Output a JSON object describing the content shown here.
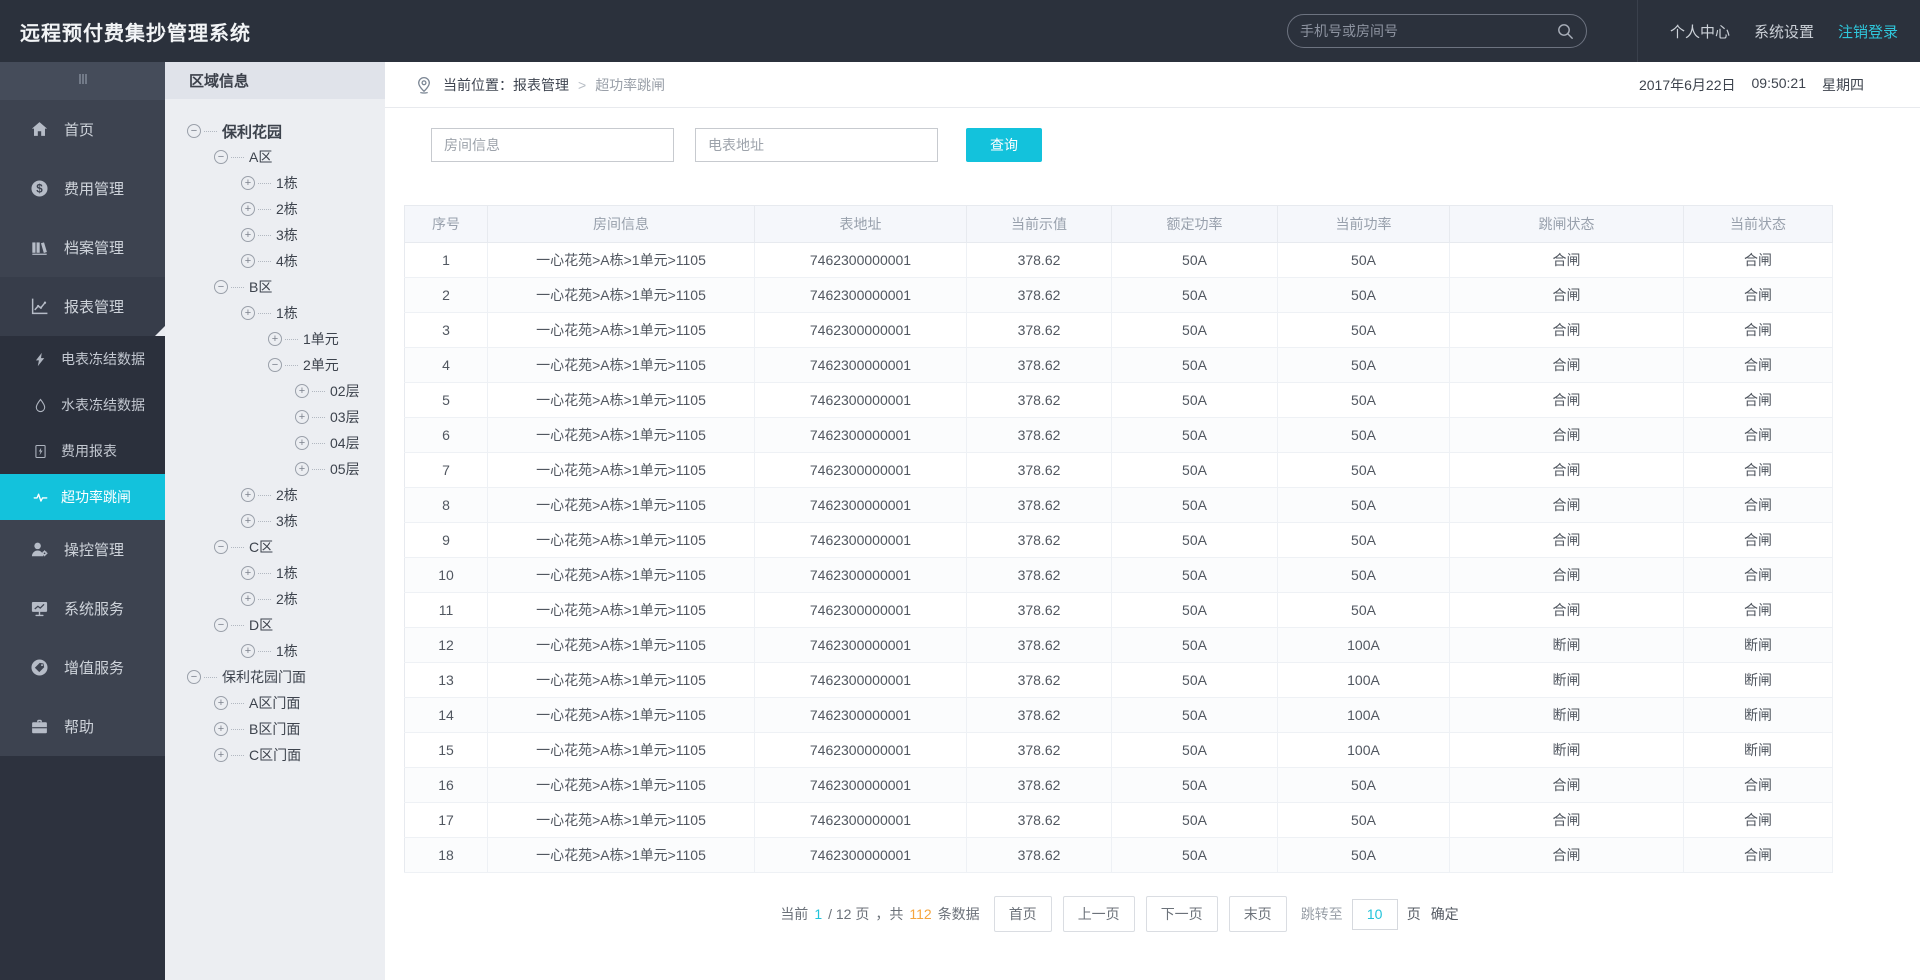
{
  "colors": {
    "accent": "#13c2dc",
    "green": "#3bd583",
    "red": "#f84d4d",
    "orange": "#f5a53d",
    "header_bg": "#2b313c",
    "sidebar_bg": "#3d4350"
  },
  "header": {
    "title": "远程预付费集抄管理系统",
    "search_placeholder": "手机号或房间号",
    "links": [
      {
        "label": "个人中心"
      },
      {
        "label": "系统设置"
      },
      {
        "label": "注销登录",
        "accent": true
      }
    ]
  },
  "sidebar": {
    "top_items": [
      {
        "label": "首页",
        "icon": "home"
      },
      {
        "label": "费用管理",
        "icon": "dollar"
      },
      {
        "label": "档案管理",
        "icon": "archive"
      },
      {
        "label": "报表管理",
        "icon": "chart",
        "expanded": true
      }
    ],
    "sub_items": [
      {
        "label": "电表冻结数据",
        "icon": "bolt"
      },
      {
        "label": "水表冻结数据",
        "icon": "drop"
      },
      {
        "label": "费用报表",
        "icon": "doc"
      },
      {
        "label": "超功率跳闸",
        "icon": "pulse",
        "active": true
      }
    ],
    "bottom_items": [
      {
        "label": "操控管理",
        "icon": "user-gear"
      },
      {
        "label": "系统服务",
        "icon": "monitor"
      },
      {
        "label": "增值服务",
        "icon": "tag"
      },
      {
        "label": "帮助",
        "icon": "briefcase"
      }
    ]
  },
  "tree": {
    "title": "区域信息",
    "nodes": [
      {
        "label": "保利花园",
        "level": 0,
        "state": "minus",
        "bold": true
      },
      {
        "label": "A区",
        "level": 1,
        "state": "minus"
      },
      {
        "label": "1栋",
        "level": 2,
        "state": "plus"
      },
      {
        "label": "2栋",
        "level": 2,
        "state": "plus"
      },
      {
        "label": "3栋",
        "level": 2,
        "state": "plus"
      },
      {
        "label": "4栋",
        "level": 2,
        "state": "plus"
      },
      {
        "label": "B区",
        "level": 1,
        "state": "minus"
      },
      {
        "label": "1栋",
        "level": 2,
        "state": "plus"
      },
      {
        "label": "1单元",
        "level": 3,
        "state": "plus"
      },
      {
        "label": "2单元",
        "level": 3,
        "state": "minus"
      },
      {
        "label": "02层",
        "level": 4,
        "state": "plus"
      },
      {
        "label": "03层",
        "level": 4,
        "state": "plus"
      },
      {
        "label": "04层",
        "level": 4,
        "state": "plus"
      },
      {
        "label": "05层",
        "level": 4,
        "state": "plus"
      },
      {
        "label": "2栋",
        "level": 2,
        "state": "plus"
      },
      {
        "label": "3栋",
        "level": 2,
        "state": "plus"
      },
      {
        "label": "C区",
        "level": 1,
        "state": "minus"
      },
      {
        "label": "1栋",
        "level": 2,
        "state": "plus"
      },
      {
        "label": "2栋",
        "level": 2,
        "state": "plus"
      },
      {
        "label": "D区",
        "level": 1,
        "state": "minus"
      },
      {
        "label": "1栋",
        "level": 2,
        "state": "plus"
      },
      {
        "label": "保利花园门面",
        "level": 0,
        "state": "minus"
      },
      {
        "label": "A区门面",
        "level": 1,
        "state": "plus"
      },
      {
        "label": "B区门面",
        "level": 1,
        "state": "plus"
      },
      {
        "label": "C区门面",
        "level": 1,
        "state": "plus"
      }
    ]
  },
  "breadcrumb": {
    "label": "当前位置：报表管理",
    "separator": ">",
    "current": "超功率跳闸"
  },
  "datetime": {
    "date": "2017年6月22日",
    "time": "09:50:21",
    "weekday": "星期四"
  },
  "filters": {
    "room_placeholder": "房间信息",
    "meter_placeholder": "电表地址",
    "search_button": "查询"
  },
  "table": {
    "columns": [
      "序号",
      "房间信息",
      "表地址",
      "当前示值",
      "额定功率",
      "当前功率",
      "跳闸状态",
      "当前状态"
    ],
    "rows": [
      {
        "no": "1",
        "room": "一心花苑>A栋>1单元>1105",
        "meter": "7462300000001",
        "reading": "378.62",
        "rated": "50A",
        "power": "50A",
        "trip": "合闸",
        "status": "合闸",
        "alarm": false
      },
      {
        "no": "2",
        "room": "一心花苑>A栋>1单元>1105",
        "meter": "7462300000001",
        "reading": "378.62",
        "rated": "50A",
        "power": "50A",
        "trip": "合闸",
        "status": "合闸",
        "alarm": false
      },
      {
        "no": "3",
        "room": "一心花苑>A栋>1单元>1105",
        "meter": "7462300000001",
        "reading": "378.62",
        "rated": "50A",
        "power": "50A",
        "trip": "合闸",
        "status": "合闸",
        "alarm": false
      },
      {
        "no": "4",
        "room": "一心花苑>A栋>1单元>1105",
        "meter": "7462300000001",
        "reading": "378.62",
        "rated": "50A",
        "power": "50A",
        "trip": "合闸",
        "status": "合闸",
        "alarm": false
      },
      {
        "no": "5",
        "room": "一心花苑>A栋>1单元>1105",
        "meter": "7462300000001",
        "reading": "378.62",
        "rated": "50A",
        "power": "50A",
        "trip": "合闸",
        "status": "合闸",
        "alarm": false
      },
      {
        "no": "6",
        "room": "一心花苑>A栋>1单元>1105",
        "meter": "7462300000001",
        "reading": "378.62",
        "rated": "50A",
        "power": "50A",
        "trip": "合闸",
        "status": "合闸",
        "alarm": false
      },
      {
        "no": "7",
        "room": "一心花苑>A栋>1单元>1105",
        "meter": "7462300000001",
        "reading": "378.62",
        "rated": "50A",
        "power": "50A",
        "trip": "合闸",
        "status": "合闸",
        "alarm": false
      },
      {
        "no": "8",
        "room": "一心花苑>A栋>1单元>1105",
        "meter": "7462300000001",
        "reading": "378.62",
        "rated": "50A",
        "power": "50A",
        "trip": "合闸",
        "status": "合闸",
        "alarm": false
      },
      {
        "no": "9",
        "room": "一心花苑>A栋>1单元>1105",
        "meter": "7462300000001",
        "reading": "378.62",
        "rated": "50A",
        "power": "50A",
        "trip": "合闸",
        "status": "合闸",
        "alarm": false
      },
      {
        "no": "10",
        "room": "一心花苑>A栋>1单元>1105",
        "meter": "7462300000001",
        "reading": "378.62",
        "rated": "50A",
        "power": "50A",
        "trip": "合闸",
        "status": "合闸",
        "alarm": false
      },
      {
        "no": "11",
        "room": "一心花苑>A栋>1单元>1105",
        "meter": "7462300000001",
        "reading": "378.62",
        "rated": "50A",
        "power": "50A",
        "trip": "合闸",
        "status": "合闸",
        "alarm": false
      },
      {
        "no": "12",
        "room": "一心花苑>A栋>1单元>1105",
        "meter": "7462300000001",
        "reading": "378.62",
        "rated": "50A",
        "power": "100A",
        "trip": "断闸",
        "status": "断闸",
        "alarm": true
      },
      {
        "no": "13",
        "room": "一心花苑>A栋>1单元>1105",
        "meter": "7462300000001",
        "reading": "378.62",
        "rated": "50A",
        "power": "100A",
        "trip": "断闸",
        "status": "断闸",
        "alarm": true
      },
      {
        "no": "14",
        "room": "一心花苑>A栋>1单元>1105",
        "meter": "7462300000001",
        "reading": "378.62",
        "rated": "50A",
        "power": "100A",
        "trip": "断闸",
        "status": "断闸",
        "alarm": true
      },
      {
        "no": "15",
        "room": "一心花苑>A栋>1单元>1105",
        "meter": "7462300000001",
        "reading": "378.62",
        "rated": "50A",
        "power": "100A",
        "trip": "断闸",
        "status": "断闸",
        "alarm": true
      },
      {
        "no": "16",
        "room": "一心花苑>A栋>1单元>1105",
        "meter": "7462300000001",
        "reading": "378.62",
        "rated": "50A",
        "power": "50A",
        "trip": "合闸",
        "status": "合闸",
        "alarm": false
      },
      {
        "no": "17",
        "room": "一心花苑>A栋>1单元>1105",
        "meter": "7462300000001",
        "reading": "378.62",
        "rated": "50A",
        "power": "50A",
        "trip": "合闸",
        "status": "合闸",
        "alarm": false
      },
      {
        "no": "18",
        "room": "一心花苑>A栋>1单元>1105",
        "meter": "7462300000001",
        "reading": "378.62",
        "rated": "50A",
        "power": "50A",
        "trip": "合闸",
        "status": "合闸",
        "alarm": false
      }
    ]
  },
  "pagination": {
    "prefix": "当前",
    "current": "1",
    "of": "/ 12 页",
    "total_label": "，共",
    "total": "112",
    "total_suffix": "条数据",
    "first": "首页",
    "prev": "上一页",
    "next": "下一页",
    "last": "末页",
    "jump_label": "跳转至",
    "jump_value": "10",
    "jump_unit": "页",
    "confirm": "确定"
  }
}
